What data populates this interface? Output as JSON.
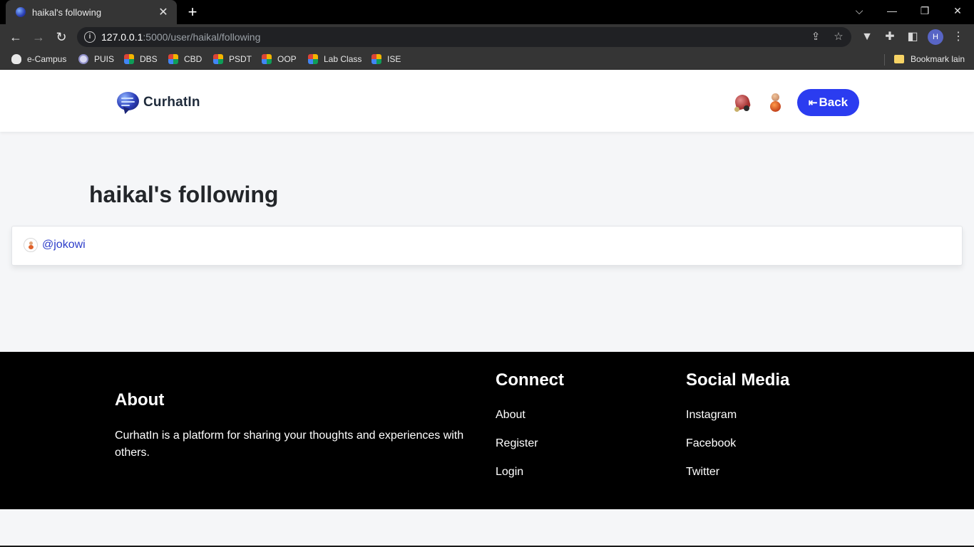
{
  "browser": {
    "tab_title": "haikal's following",
    "tab_close": "✕",
    "new_tab": "+",
    "url_host": "127.0.0.1",
    "url_rest": ":5000/user/haikal/following",
    "profile_initial": "H",
    "bookmarks": [
      {
        "label": "e-Campus",
        "icon": "campus-icon"
      },
      {
        "label": "PUIS",
        "icon": "puis-icon"
      },
      {
        "label": "DBS",
        "icon": "classroom-icon"
      },
      {
        "label": "CBD",
        "icon": "classroom-icon"
      },
      {
        "label": "PSDT",
        "icon": "classroom-icon"
      },
      {
        "label": "OOP",
        "icon": "classroom-icon"
      },
      {
        "label": "Lab Class",
        "icon": "classroom-icon"
      },
      {
        "label": "ISE",
        "icon": "classroom-icon"
      }
    ],
    "other_bookmarks": "Bookmark lain"
  },
  "navbar": {
    "brand": "CurhatIn",
    "back_label": "Back"
  },
  "main": {
    "title": "haikal's following",
    "following": [
      {
        "username": "@jokowi"
      }
    ]
  },
  "footer": {
    "about_heading": "About",
    "about_text": "CurhatIn is a platform for sharing your thoughts and experiences with others.",
    "connect_heading": "Connect",
    "connect_links": [
      "About",
      "Register",
      "Login"
    ],
    "social_heading": "Social Media",
    "social_links": [
      "Instagram",
      "Facebook",
      "Twitter"
    ]
  },
  "colors": {
    "accent": "#2b3cf0",
    "link": "#2b3cc9",
    "footer_bg": "#000000",
    "page_bg": "#f5f6f8"
  }
}
